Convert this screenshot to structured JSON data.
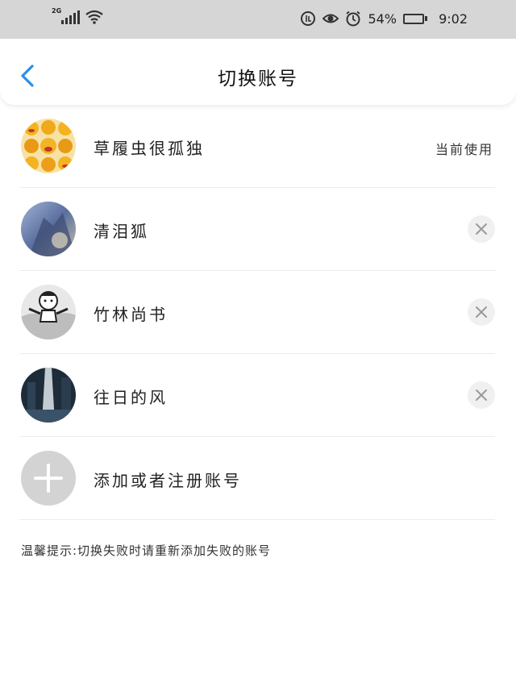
{
  "status_bar": {
    "network": "2G",
    "battery_percent": "54%",
    "battery_level": 0.54,
    "time": "9:02",
    "icons": [
      "signal-icon",
      "wifi-icon",
      "data-saver-icon",
      "eye-icon",
      "alarm-icon",
      "battery-icon"
    ]
  },
  "header": {
    "title": "切换账号",
    "back_icon": "chevron-left-icon"
  },
  "accounts": [
    {
      "name": "草履虫很孤独",
      "status": "当前使用"
    },
    {
      "name": "清泪狐",
      "remove_icon": "close-icon"
    },
    {
      "name": "竹林尚书",
      "remove_icon": "close-icon"
    },
    {
      "name": "往日的风",
      "remove_icon": "close-icon"
    }
  ],
  "add_account": {
    "label": "添加或者注册账号",
    "icon": "plus-icon"
  },
  "tip": "温馨提示:切换失败时请重新添加失败的账号",
  "colors": {
    "accent": "#2b8fe8",
    "status_bar_bg": "#d6d6d6",
    "divider": "#ececec",
    "add_circle": "#d3d3d3",
    "remove_bg": "#f0f0f0"
  }
}
